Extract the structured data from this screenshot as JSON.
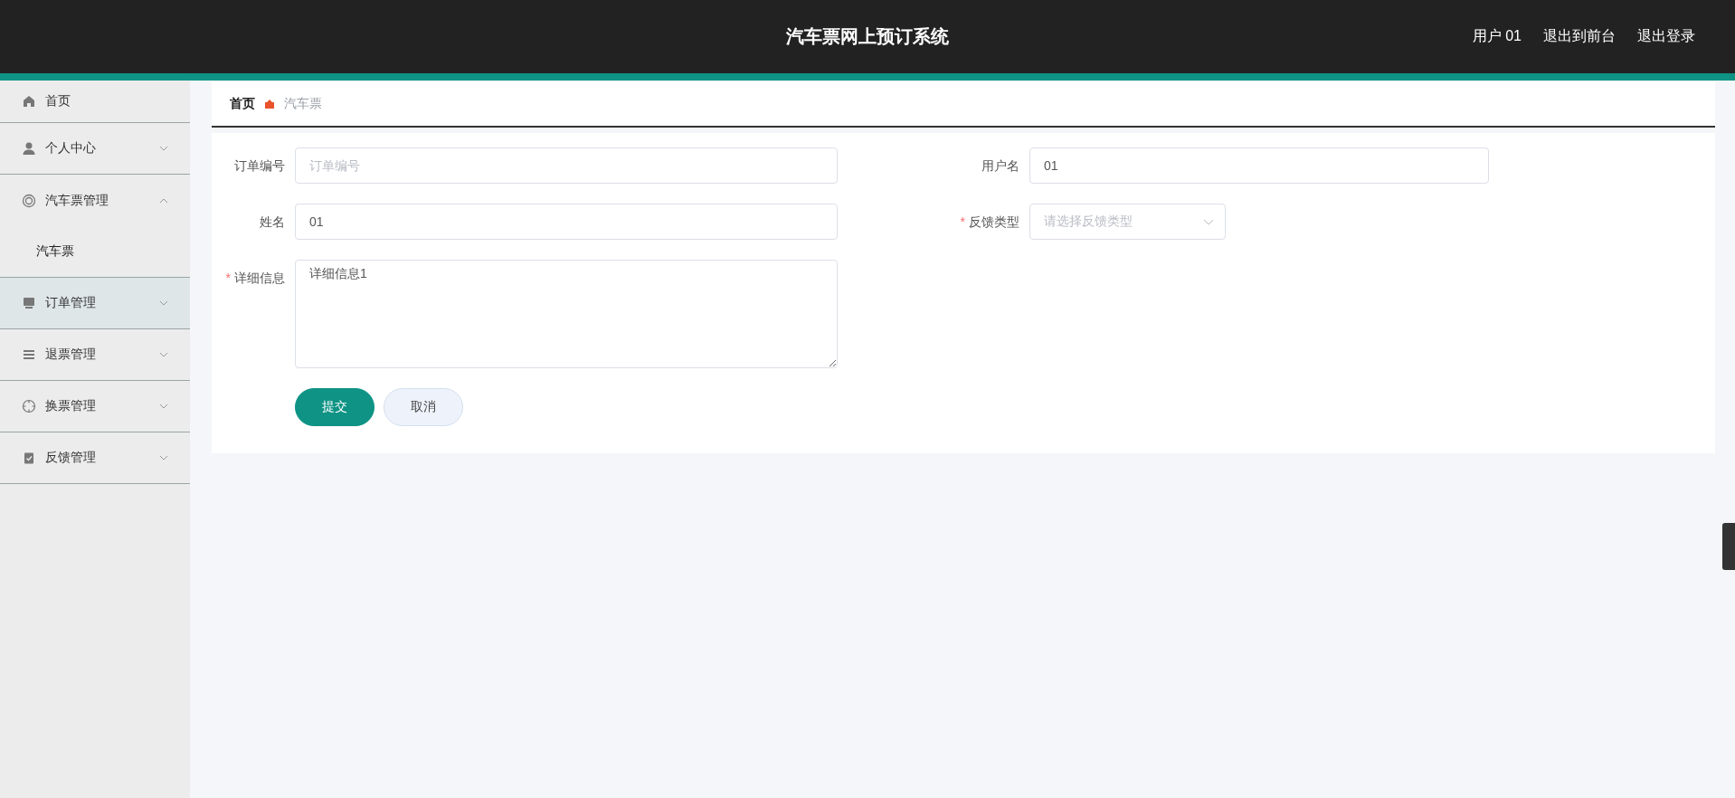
{
  "header": {
    "title": "汽车票网上预订系统",
    "links": [
      "用户 01",
      "退出到前台",
      "退出登录"
    ]
  },
  "sidebar": {
    "items": [
      {
        "label": "首页",
        "has_arrow": false,
        "hovered": false
      },
      {
        "label": "个人中心",
        "has_arrow": true,
        "expanded": false,
        "hovered": false
      },
      {
        "label": "汽车票管理",
        "has_arrow": true,
        "expanded": true,
        "hovered": false,
        "children": [
          {
            "label": "汽车票"
          }
        ]
      },
      {
        "label": "订单管理",
        "has_arrow": true,
        "expanded": false,
        "hovered": true
      },
      {
        "label": "退票管理",
        "has_arrow": true,
        "expanded": false,
        "hovered": false
      },
      {
        "label": "换票管理",
        "has_arrow": true,
        "expanded": false,
        "hovered": false
      },
      {
        "label": "反馈管理",
        "has_arrow": true,
        "expanded": false,
        "hovered": false
      }
    ]
  },
  "breadcrumb": [
    "首页",
    "汽车票"
  ],
  "form": {
    "fields": [
      {
        "kind": "input",
        "label": "订单编号",
        "placeholder": "订单编号"
      },
      {
        "kind": "input",
        "label": "用户名",
        "value": "01"
      },
      {
        "kind": "input",
        "label": "姓名",
        "value": "01"
      },
      {
        "kind": "select",
        "label": "反馈类型",
        "required_mark": "*",
        "placeholder": "请选择反馈类型"
      },
      {
        "kind": "textarea",
        "label": "详细信息",
        "required_mark": "*",
        "value": "详细信息1"
      }
    ],
    "buttons": [
      {
        "label": "提交",
        "kind": "primary"
      },
      {
        "label": "取消",
        "kind": "secondary"
      }
    ]
  }
}
